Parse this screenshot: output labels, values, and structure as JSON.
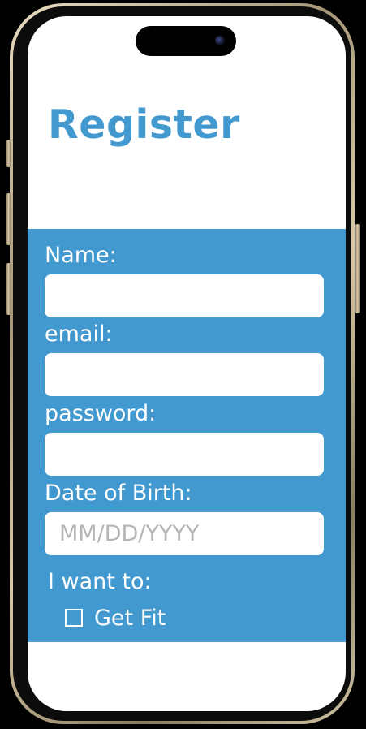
{
  "page": {
    "title": "Register"
  },
  "form": {
    "name_label": "Name:",
    "name_value": "",
    "email_label": "email:",
    "email_value": "",
    "password_label": "password:",
    "password_value": "",
    "dob_label": "Date of Birth:",
    "dob_value": "",
    "dob_placeholder": "MM/DD/YYYY",
    "goals_label": "I want to:",
    "goals": [
      {
        "label": "Get Fit",
        "checked": false
      }
    ]
  },
  "colors": {
    "accent": "#4299cf",
    "field_background": "#ffffff",
    "placeholder": "#b5b5b5",
    "device_frame": "#c9b996"
  }
}
